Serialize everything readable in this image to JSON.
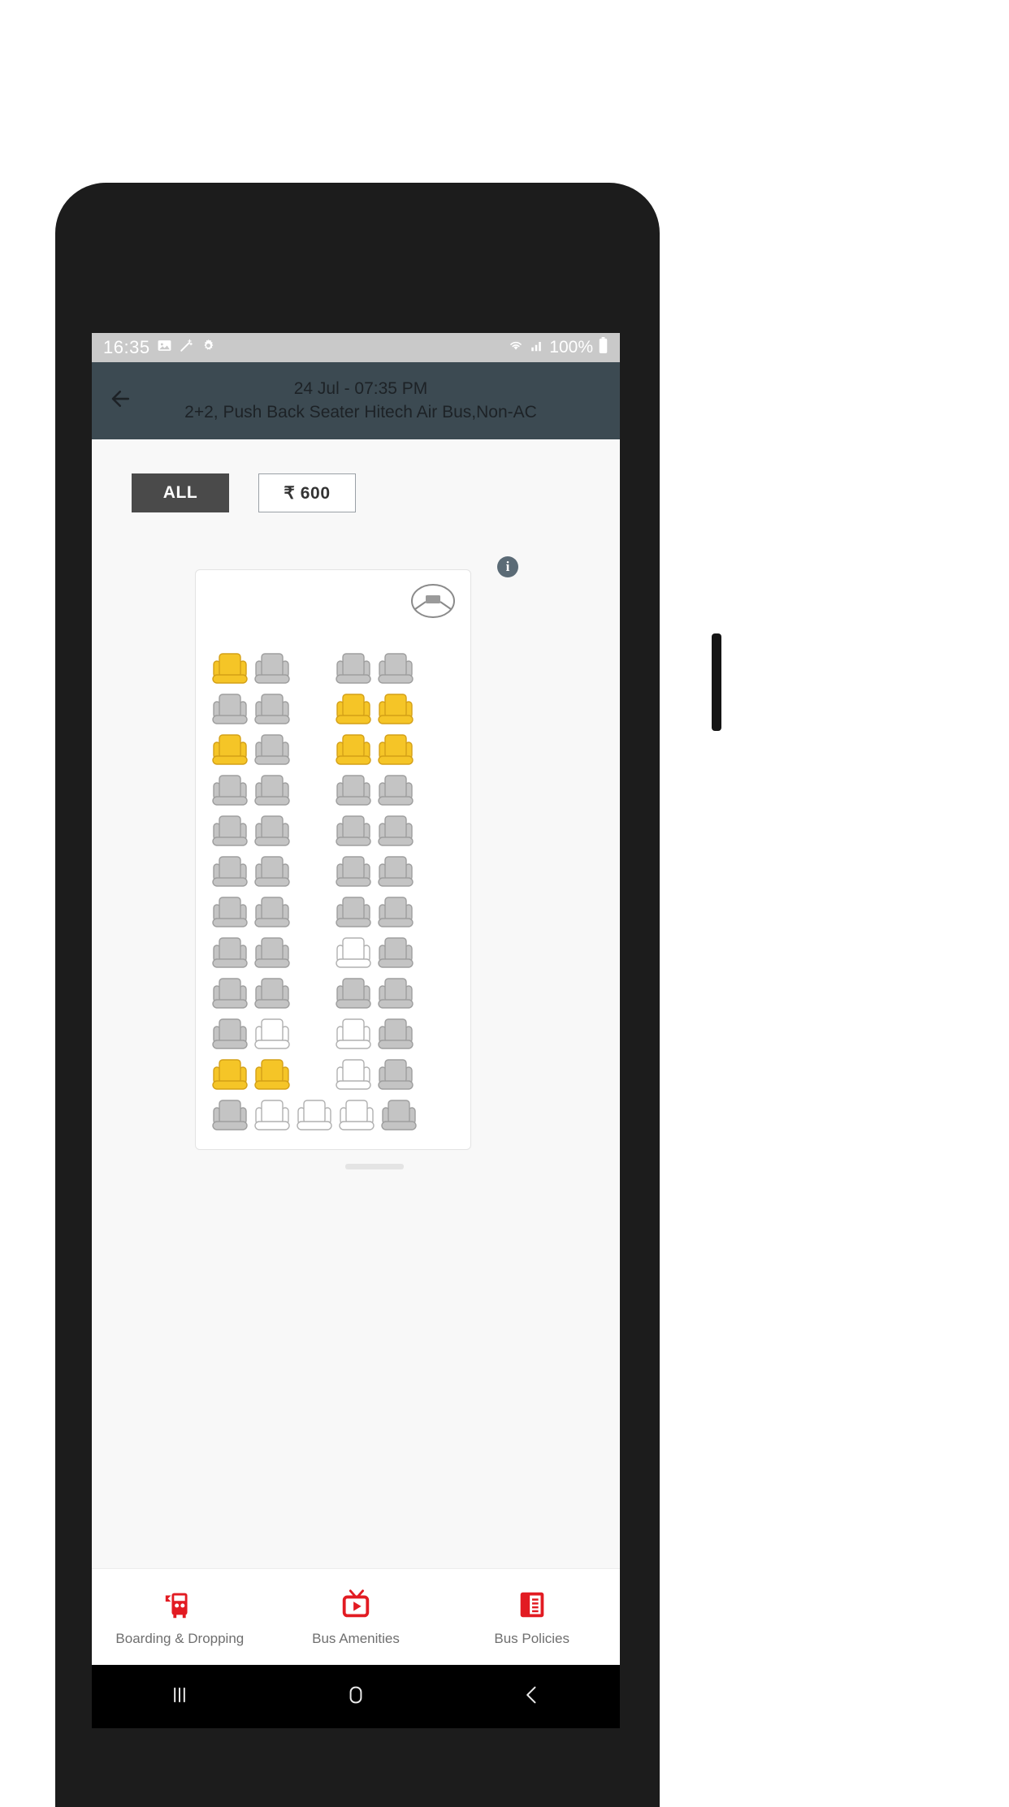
{
  "status_bar": {
    "time": "16:35",
    "battery_text": "100%",
    "icons": [
      "image-icon",
      "magic-wand-icon",
      "gear-icon",
      "wifi-icon",
      "signal-icon",
      "battery-icon"
    ]
  },
  "header": {
    "back_icon": "arrow-left-icon",
    "line1": "24 Jul - 07:35 PM",
    "line2": "2+2, Push Back Seater Hitech Air Bus,Non-AC",
    "background": "#3c4a52"
  },
  "filters": [
    {
      "label": "ALL",
      "selected": true
    },
    {
      "label": "₹ 600",
      "selected": false
    }
  ],
  "seat_map": {
    "info_icon": "info-icon",
    "info_label": "i",
    "steering_icon": "steering-wheel-icon",
    "legend_colors": {
      "selected": "#f5c527",
      "selected_border": "#d4a017",
      "available": "#c4c4c4",
      "available_border": "#9e9e9e",
      "unavailable": "#ffffff",
      "unavailable_border": "#b0b0b0"
    },
    "columns": 5,
    "rows": [
      [
        "selected",
        "available",
        "gap",
        "available",
        "available"
      ],
      [
        "available",
        "available",
        "gap",
        "selected",
        "selected"
      ],
      [
        "selected",
        "available",
        "gap",
        "selected",
        "selected"
      ],
      [
        "available",
        "available",
        "gap",
        "available",
        "available"
      ],
      [
        "available",
        "available",
        "gap",
        "available",
        "available"
      ],
      [
        "available",
        "available",
        "gap",
        "available",
        "available"
      ],
      [
        "available",
        "available",
        "gap",
        "available",
        "available"
      ],
      [
        "available",
        "available",
        "gap",
        "unavailable",
        "available"
      ],
      [
        "available",
        "available",
        "gap",
        "available",
        "available"
      ],
      [
        "available",
        "unavailable",
        "gap",
        "unavailable",
        "available"
      ],
      [
        "selected",
        "selected",
        "gap",
        "unavailable",
        "available"
      ],
      [
        "available",
        "unavailable",
        "unavailable",
        "unavailable",
        "available"
      ]
    ]
  },
  "bottom_nav": [
    {
      "label": "Boarding & Dropping",
      "icon": "bus-icon"
    },
    {
      "label": "Bus Amenities",
      "icon": "tv-play-icon"
    },
    {
      "label": "Bus Policies",
      "icon": "document-icon"
    }
  ],
  "android_nav": [
    {
      "name": "recents-button",
      "icon": "recents-icon"
    },
    {
      "name": "home-button",
      "icon": "home-icon"
    },
    {
      "name": "back-button",
      "icon": "back-chevron-icon"
    }
  ]
}
